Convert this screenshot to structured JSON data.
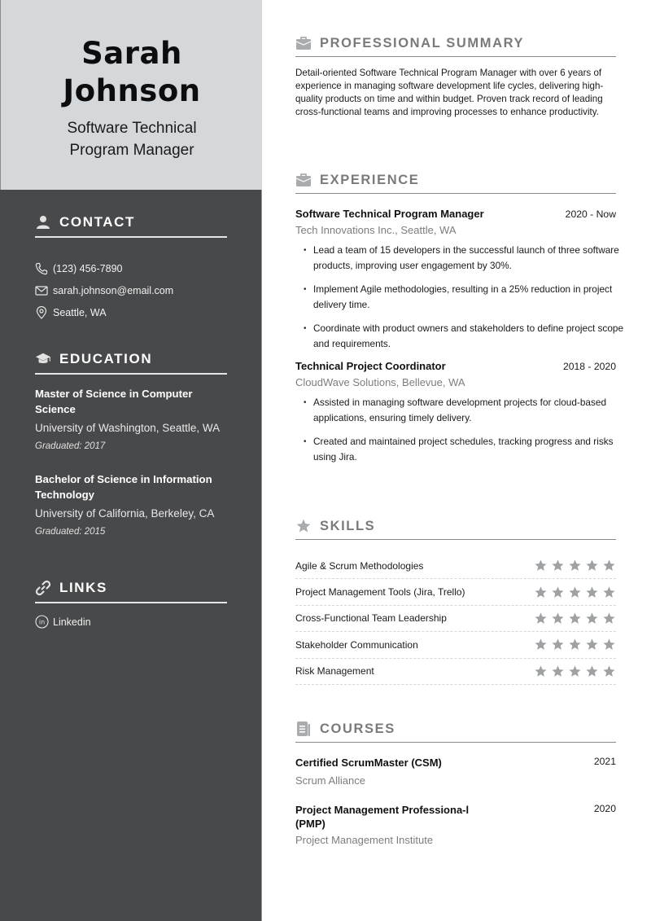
{
  "header": {
    "name_first": "Sarah",
    "name_last": "Johnson",
    "role_line1": "Software Technical",
    "role_line2": "Program Manager"
  },
  "contact": {
    "heading": "CONTACT",
    "icon": "user-icon",
    "items": [
      {
        "icon": "phone-icon",
        "text": "(123) 456-7890"
      },
      {
        "icon": "email-icon",
        "text": "sarah.johnson@email.com"
      },
      {
        "icon": "location-pin-icon",
        "text": "Seattle, WA"
      }
    ]
  },
  "education": {
    "heading": "EDUCATION",
    "icon": "graduation-cap-icon",
    "items": [
      {
        "degree": "Master of Science in Computer Science",
        "school": "University of Washington, Seattle, WA",
        "graduated": "Graduated: 2017"
      },
      {
        "degree": "Bachelor of Science in Information Technology",
        "school": "University of California, Berkeley, CA",
        "graduated": "Graduated: 2015"
      }
    ]
  },
  "links": {
    "heading": "LINKS",
    "icon": "link-icon",
    "items": [
      {
        "icon": "linkedin-icon",
        "text": "Linkedin"
      }
    ]
  },
  "summary": {
    "heading": "PROFESSIONAL SUMMARY",
    "icon": "briefcase-icon",
    "text": "Detail-oriented Software Technical Program Manager with over 6 years of experience in managing software development life cycles, delivering high-quality products on time and within budget. Proven track record of leading cross-functional teams and improving processes to enhance productivity."
  },
  "experience": {
    "heading": "EXPERIENCE",
    "icon": "briefcase-icon",
    "jobs": [
      {
        "title": "Software Technical Program Manager",
        "dates": "2020 - Now",
        "company": "Tech Innovations Inc., Seattle, WA",
        "bullets": [
          "Lead a team of 15 developers in the successful launch of three software products, improving user engagement by 30%.",
          "Implement Agile methodologies, resulting in a 25% reduction in project delivery time.",
          "Coordinate with product owners and stakeholders to define project scope and requirements."
        ]
      },
      {
        "title": "Technical Project Coordinator",
        "dates": "2018 - 2020",
        "company": "CloudWave Solutions, Bellevue, WA",
        "bullets": [
          "Assisted in managing software development projects for cloud-based applications, ensuring timely delivery.",
          "Created and maintained project schedules, tracking progress and risks using Jira."
        ]
      }
    ]
  },
  "skills": {
    "heading": "SKILLS",
    "icon": "star-icon",
    "max_rating": 5,
    "items": [
      {
        "name": "Agile & Scrum Methodologies",
        "rating": 5
      },
      {
        "name": "Project Management Tools (Jira, Trello)",
        "rating": 5
      },
      {
        "name": "Cross-Functional Team Leadership",
        "rating": 5
      },
      {
        "name": "Stakeholder Communication",
        "rating": 5
      },
      {
        "name": "Risk Management",
        "rating": 5
      }
    ]
  },
  "courses": {
    "heading": "COURSES",
    "icon": "document-icon",
    "items": [
      {
        "title": "Certified ScrumMaster (CSM)",
        "year": "2021",
        "org": "Scrum Alliance"
      },
      {
        "title": "Project Management Professiona-l (PMP)",
        "year": "2020",
        "org": "Project Management Institute"
      }
    ]
  },
  "colors": {
    "sidebar_bg": "#48494b",
    "header_bg": "#d4d8db",
    "heading_gray": "#7a7a7a",
    "star_gray": "#9ea2a5",
    "company_gray": "#7d7d7d"
  }
}
